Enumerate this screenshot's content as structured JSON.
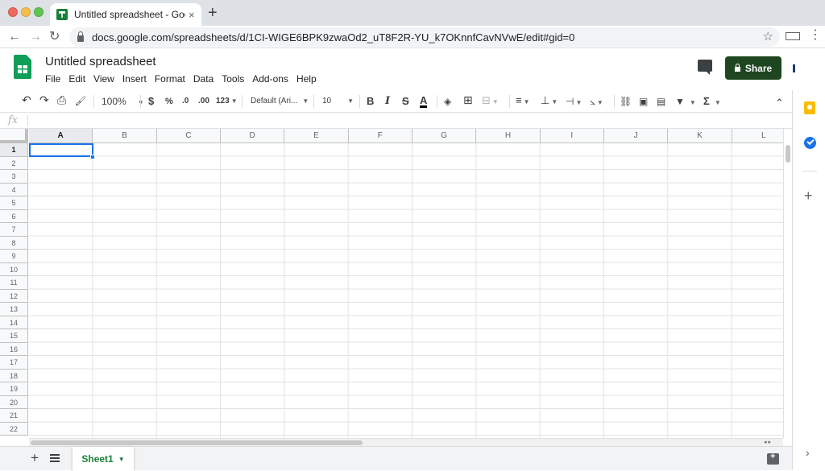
{
  "browser": {
    "tab_title": "Untitled spreadsheet - Google",
    "tab_close": "×",
    "new_tab": "+",
    "back": "←",
    "forward": "→",
    "reload": "↻",
    "url": "docs.google.com/spreadsheets/d/1CI-WIGE6BPK9zwaOd2_uT8F2R-YU_k7OKnnfCavNVwE/edit#gid=0",
    "bookmark_star": "☆",
    "menu_kebab": "⋮"
  },
  "doc": {
    "title": "Untitled spreadsheet",
    "menu": [
      "File",
      "Edit",
      "View",
      "Insert",
      "Format",
      "Data",
      "Tools",
      "Add-ons",
      "Help"
    ],
    "share_label": "Share"
  },
  "toolbar": {
    "undo": "↶",
    "redo": "↷",
    "print": "⎙",
    "paint_format": "🖌",
    "zoom": "100%",
    "currency": "$",
    "percent": "%",
    "decrease_decimal": ".0",
    "increase_decimal": ".00",
    "more_formats": "123",
    "font": "Default (Ari...",
    "font_size": "10",
    "bold": "B",
    "italic": "I",
    "strikethrough": "S",
    "text_color": "A",
    "collapse": "⌃"
  },
  "formula": {
    "fx": "fx",
    "value": ""
  },
  "grid": {
    "columns": [
      "A",
      "B",
      "C",
      "D",
      "E",
      "F",
      "G",
      "H",
      "I",
      "J",
      "K",
      "L"
    ],
    "rows": [
      "1",
      "2",
      "3",
      "4",
      "5",
      "6",
      "7",
      "8",
      "9",
      "10",
      "11",
      "12",
      "13",
      "14",
      "15",
      "16",
      "17",
      "18",
      "19",
      "20",
      "21",
      "22"
    ],
    "active_cell": "A1"
  },
  "sheets": {
    "add": "+",
    "tabs": [
      {
        "label": "Sheet1",
        "active": true
      }
    ]
  },
  "side_panel": {
    "add": "+",
    "expand": "›"
  },
  "colors": {
    "accent": "#1a73e8",
    "share_button": "#1e4620",
    "sheets_green": "#0f9d58",
    "sheet_tab_text": "#188038"
  }
}
